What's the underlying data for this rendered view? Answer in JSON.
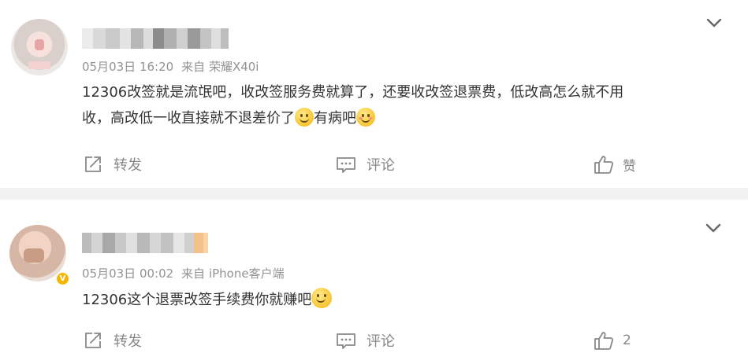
{
  "comments": [
    {
      "time": "05月03日 16:20",
      "source": "来自 荣耀X40i",
      "text_line1": "12306改签就是流氓吧，收改签服务费就算了，还要收改签退票费，低改高怎么就不用",
      "text_line2a": "收，高改低一收直接就不退差价了",
      "text_line2b": "有病吧",
      "emoji1": "smile-emoji",
      "emoji2": "blush-emoji",
      "repost_label": "转发",
      "comment_label": "评论",
      "like_label": "赞"
    },
    {
      "time": "05月03日 00:02",
      "source": "来自 iPhone客户端",
      "text": "12306这个退票改签手续费你就赚吧",
      "emoji1": "hug-emoji",
      "repost_label": "转发",
      "comment_label": "评论",
      "like_label": "2",
      "badge": "V"
    }
  ],
  "colors": {
    "meta": "#939393",
    "text": "#333333",
    "action": "#888888",
    "badge": "#f7b500",
    "background": "#f2f2f2"
  }
}
